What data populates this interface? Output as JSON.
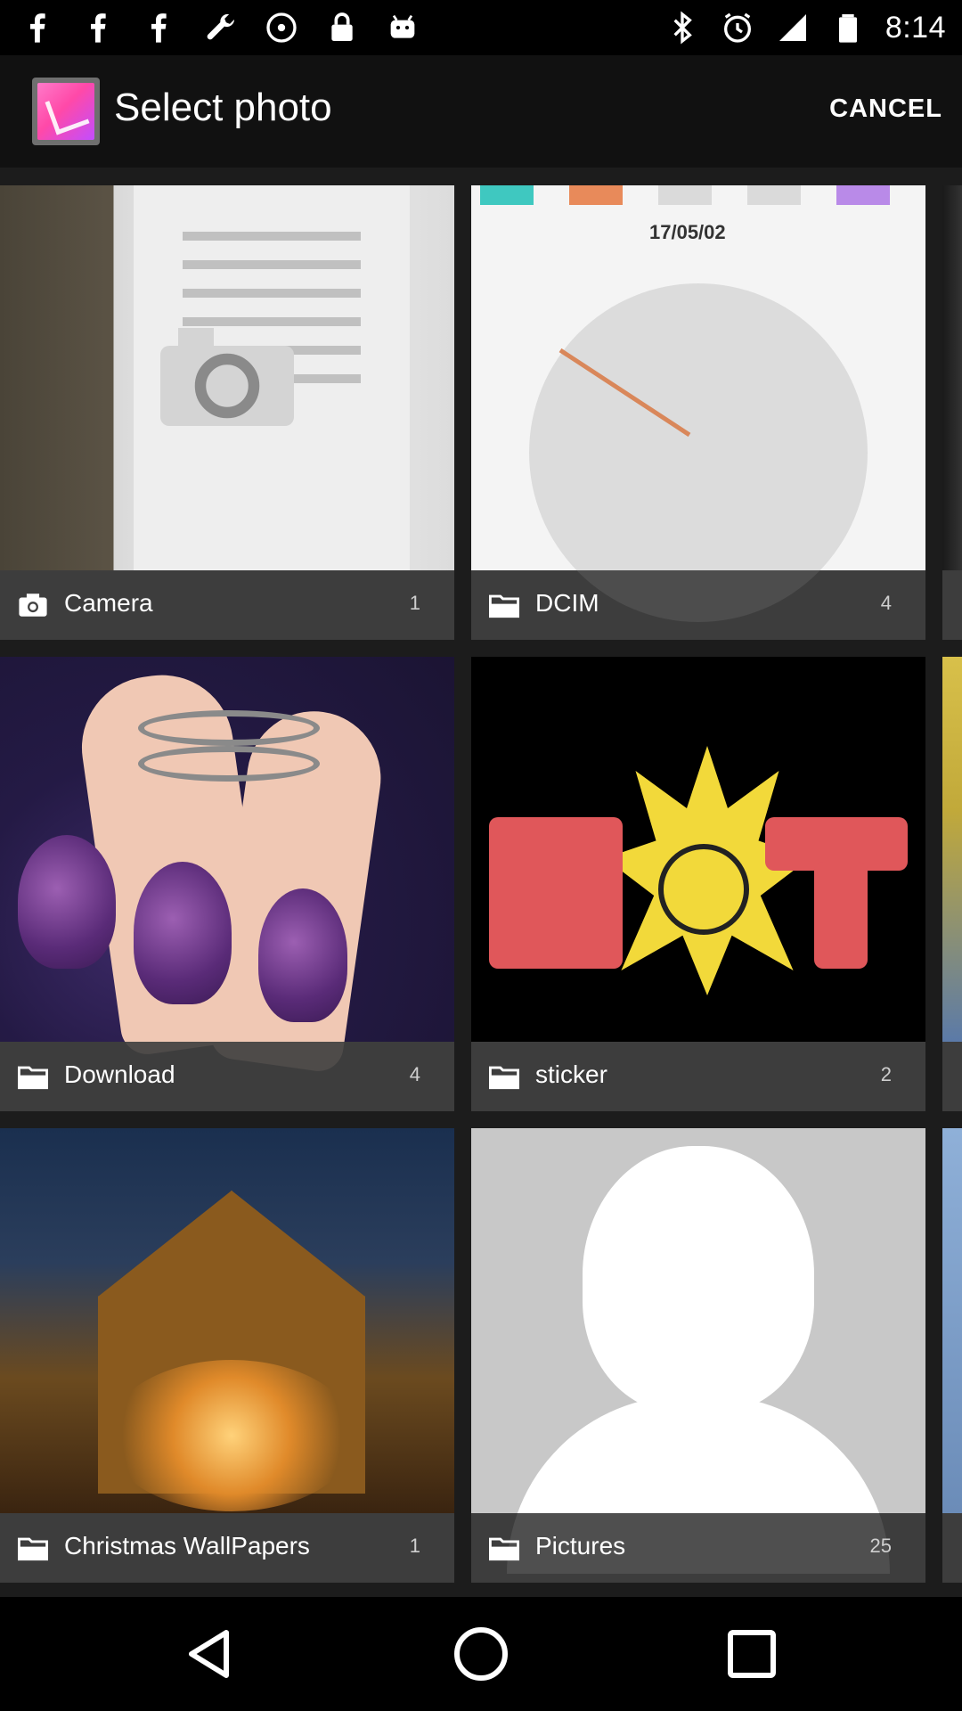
{
  "status_bar": {
    "time": "8:14",
    "left_icons": [
      "facebook-icon",
      "facebook-icon",
      "facebook-icon",
      "wrench-icon",
      "cd-icon",
      "lock-icon",
      "android-icon"
    ],
    "right_icons": [
      "bluetooth-icon",
      "alarm-icon",
      "signal-icon",
      "battery-icon"
    ]
  },
  "app_bar": {
    "title": "Select photo",
    "cancel_label": "CANCEL"
  },
  "albums": [
    {
      "name": "Camera",
      "count": "1",
      "icon": "camera-icon"
    },
    {
      "name": "DCIM",
      "count": "4",
      "icon": "folder-icon"
    },
    {
      "name": "Download",
      "count": "4",
      "icon": "folder-icon"
    },
    {
      "name": "sticker",
      "count": "2",
      "icon": "folder-icon"
    },
    {
      "name": "Christmas WallPapers",
      "count": "1",
      "icon": "folder-icon"
    },
    {
      "name": "Pictures",
      "count": "25",
      "icon": "folder-icon"
    }
  ],
  "thumb_text": {
    "dcim_date": "17/05/02"
  },
  "nav_bar": {
    "buttons": [
      "back-icon",
      "home-icon",
      "recents-icon"
    ]
  }
}
